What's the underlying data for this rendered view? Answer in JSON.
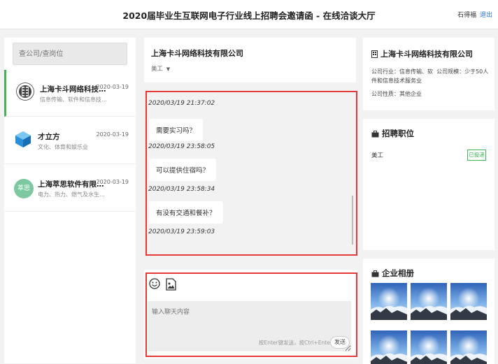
{
  "header": {
    "title": "2020届毕业生互联网电子行业线上招聘会邀请函 - 在线洽谈大厅",
    "user_name": "石得福",
    "logout_label": "退出"
  },
  "search": {
    "placeholder": "查公司/查岗位"
  },
  "conversations": [
    {
      "name": "上海卡斗网络科技有限公司",
      "date": "2020-03-19",
      "industry": "信息传输、软件和信息技术服务业",
      "active": true
    },
    {
      "name": "才立方",
      "date": "2020-03-19",
      "industry": "文化、体育和娱乐业",
      "active": false
    },
    {
      "name": "上海萃思软件有限公司",
      "date": "2020-03-19",
      "industry": "电力、热力、燃气及水生产和供应业",
      "avatar_text": "萃思",
      "active": false
    }
  ],
  "chat": {
    "company": "上海卡斗网络科技有限公司",
    "position": "美工",
    "messages": [
      {
        "time": "2020/03/19 21:37:02",
        "text": "需要实习吗？"
      },
      {
        "time": "2020/03/19 23:58:05",
        "text": "可以提供住宿吗？"
      },
      {
        "time": "2020/03/19 23:58:34",
        "text": "有没有交通和餐补？"
      },
      {
        "time": "2020/03/19 23:59:03",
        "text": ""
      }
    ],
    "input_placeholder": "输入聊天内容",
    "hint": "按Enter键发送，按Ctrl+Enter换行",
    "send_label": "发送",
    "tools": [
      "emoji-icon",
      "image-icon"
    ]
  },
  "company_info": {
    "name": "上海卡斗网络科技有限公司",
    "industry_line": "公司行业：信息传输、软",
    "industry_line2": "件和信息技术服务业",
    "scale": "公司规模：少于50人",
    "nature": "公司性质：其他企业"
  },
  "jobs": {
    "heading": "招聘职位",
    "items": [
      {
        "title": "美工",
        "status": "已投递"
      }
    ]
  },
  "album": {
    "heading": "企业相册",
    "count": 6
  },
  "colors": {
    "accent_green": "#3fb557",
    "highlight_red": "#e53935",
    "link_blue": "#2b6fd6"
  }
}
